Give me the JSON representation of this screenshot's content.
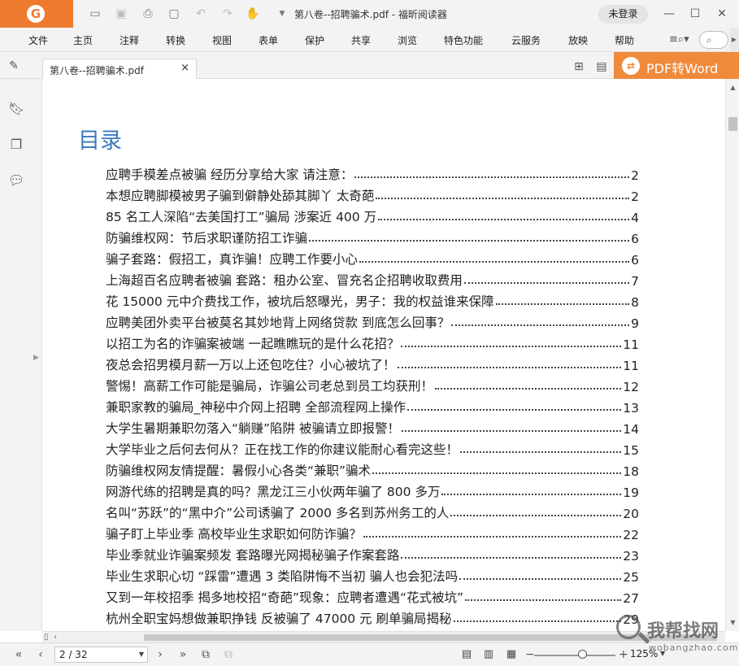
{
  "app": {
    "logo_glyph": "G",
    "title": "第八卷--招聘骗术.pdf - 福昕阅读器",
    "login_label": "未登录",
    "accent_color": "#ee7a2d"
  },
  "quick_access": [
    {
      "icon": "open-folder-icon"
    },
    {
      "icon": "save-icon"
    },
    {
      "icon": "print-icon"
    },
    {
      "icon": "new-file-icon"
    },
    {
      "icon": "undo-icon"
    },
    {
      "icon": "redo-icon"
    },
    {
      "icon": "hand-tool-icon"
    },
    {
      "icon": "customize-dropdown-icon"
    }
  ],
  "menu": {
    "items": [
      "文件",
      "主页",
      "注释",
      "转换",
      "视图",
      "表单",
      "保护",
      "共享",
      "浏览",
      "特色功能",
      "云服务",
      "放映",
      "帮助"
    ]
  },
  "tab": {
    "filename": "第八卷--招聘骗术.pdf",
    "close_glyph": "×"
  },
  "promo": {
    "label": "PDF转Word"
  },
  "document": {
    "toc_heading": "目录",
    "toc": [
      {
        "text": "应聘手模差点被骗 经历分享给大家 请注意：",
        "page": "2"
      },
      {
        "text": "本想应聘脚模被男子骗到僻静处舔其脚丫 太奇葩",
        "page": "2"
      },
      {
        "text": "85 名工人深陷“去美国打工”骗局 涉案近 400 万",
        "page": "4"
      },
      {
        "text": "防骗维权网：节后求职谨防招工诈骗",
        "page": "6"
      },
      {
        "text": "骗子套路：假招工，真诈骗！应聘工作要小心",
        "page": "6"
      },
      {
        "text": "上海超百名应聘者被骗 套路：租办公室、冒充名企招聘收取费用",
        "page": "7"
      },
      {
        "text": "花 15000 元中介费找工作，被坑后怒曝光，男子：我的权益谁来保障",
        "page": "8"
      },
      {
        "text": "应聘美团外卖平台被莫名其妙地背上网络贷款 到底怎么回事？",
        "page": "9"
      },
      {
        "text": "以招工为名的诈骗案被端 一起瞧瞧玩的是什么花招？",
        "page": "11"
      },
      {
        "text": "夜总会招男模月薪一万以上还包吃住？小心被坑了！",
        "page": "11"
      },
      {
        "text": "警惕！高薪工作可能是骗局，诈骗公司老总到员工均获刑！",
        "page": "12"
      },
      {
        "text": "兼职家教的骗局_神秘中介网上招聘 全部流程网上操作",
        "page": "13"
      },
      {
        "text": "大学生暑期兼职勿落入“躺赚”陷阱 被骗请立即报警！",
        "page": "14"
      },
      {
        "text": "大学毕业之后何去何从？正在找工作的你建议能耐心看完这些！",
        "page": "15"
      },
      {
        "text": "防骗维权网友情提醒：暑假小心各类“兼职”骗术",
        "page": "18"
      },
      {
        "text": "网游代练的招聘是真的吗？黑龙江三小伙两年骗了 800 多万",
        "page": "19"
      },
      {
        "text": "名叫“苏跃”的“黑中介”公司诱骗了 2000 多名到苏州务工的人",
        "page": "20"
      },
      {
        "text": "骗子盯上毕业季 高校毕业生求职如何防诈骗？",
        "page": "22"
      },
      {
        "text": "毕业季就业诈骗案频发 套路曝光网揭秘骗子作案套路",
        "page": "23"
      },
      {
        "text": "毕业生求职心切 “踩雷”遭遇 3 类陷阱悔不当初 骗人也会犯法吗",
        "page": "25"
      },
      {
        "text": "又到一年校招季 揭多地校招“奇葩”现象：应聘者遭遇“花式被坑”",
        "page": "27"
      },
      {
        "text": "杭州全职宝妈想做兼职挣钱 反被骗了 47000 元 刷单骗局揭秘",
        "page": "29"
      }
    ]
  },
  "status": {
    "page_value": "2 / 32",
    "zoom_value": "125%",
    "zoom_level_percent": 125
  },
  "watermark": {
    "text": "我帮找网",
    "url": "wobangzhao.com"
  }
}
